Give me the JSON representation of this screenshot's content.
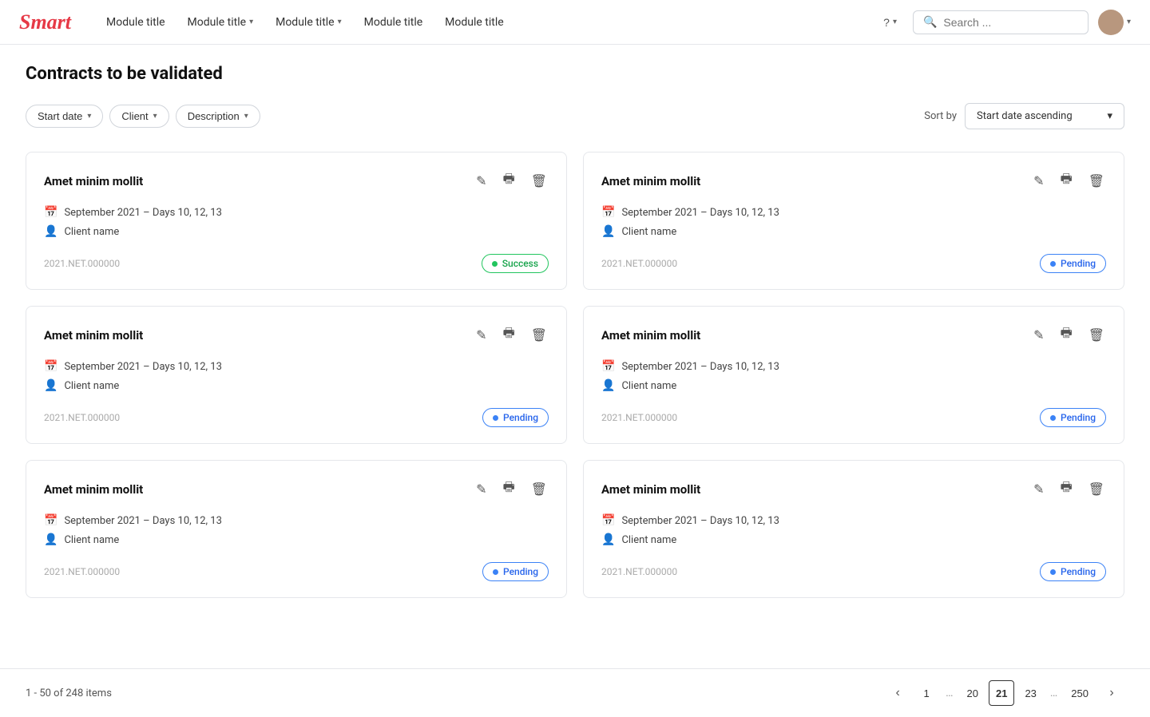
{
  "brand": {
    "logo": "Smart"
  },
  "nav": {
    "items": [
      {
        "label": "Module title",
        "hasDropdown": false
      },
      {
        "label": "Module title",
        "hasDropdown": true
      },
      {
        "label": "Module title",
        "hasDropdown": true
      },
      {
        "label": "Module title",
        "hasDropdown": false
      },
      {
        "label": "Module title",
        "hasDropdown": false
      }
    ]
  },
  "topbar": {
    "help_label": "?",
    "search_placeholder": "Search ...",
    "avatar_alt": "User avatar"
  },
  "page": {
    "title": "Contracts to be validated"
  },
  "filters": {
    "items": [
      {
        "label": "Start date"
      },
      {
        "label": "Client"
      },
      {
        "label": "Description"
      }
    ],
    "sort_label": "Sort by",
    "sort_value": "Start date ascending"
  },
  "cards": [
    {
      "title": "Amet minim mollit",
      "date": "September 2021 – Days 10, 12, 13",
      "client": "Client name",
      "id": "2021.NET.000000",
      "status": "success",
      "status_label": "Success"
    },
    {
      "title": "Amet minim mollit",
      "date": "September 2021 – Days 10, 12, 13",
      "client": "Client name",
      "id": "2021.NET.000000",
      "status": "pending",
      "status_label": "Pending"
    },
    {
      "title": "Amet minim mollit",
      "date": "September 2021 – Days 10, 12, 13",
      "client": "Client name",
      "id": "2021.NET.000000",
      "status": "pending",
      "status_label": "Pending"
    },
    {
      "title": "Amet minim mollit",
      "date": "September 2021 – Days 10, 12, 13",
      "client": "Client name",
      "id": "2021.NET.000000",
      "status": "pending",
      "status_label": "Pending"
    },
    {
      "title": "Amet minim mollit",
      "date": "September 2021 – Days 10, 12, 13",
      "client": "Client name",
      "id": "2021.NET.000000",
      "status": "pending",
      "status_label": "Pending"
    },
    {
      "title": "Amet minim mollit",
      "date": "September 2021 – Days 10, 12, 13",
      "client": "Client name",
      "id": "2021.NET.000000",
      "status": "pending",
      "status_label": "Pending"
    }
  ],
  "pagination": {
    "info": "1 - 50 of 248 items",
    "pages": [
      "1",
      "...",
      "20",
      "21",
      "23",
      "...",
      "250"
    ],
    "current": "21",
    "prev_label": "‹",
    "next_label": "›"
  }
}
